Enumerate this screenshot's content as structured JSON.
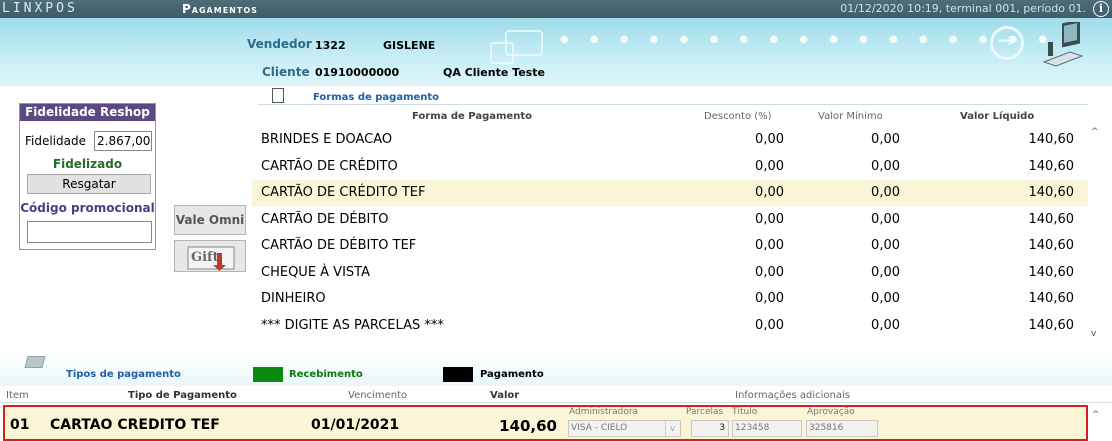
{
  "titlebar": {
    "logo": "LINXPOS",
    "section": "Pagamentos",
    "status": "01/12/2020 10:19, terminal 001, período 01.",
    "info_glyph": "i"
  },
  "header": {
    "vendedor_label": "Vendedor",
    "vendedor_code": "1322",
    "vendedor_name": "GISLENE",
    "cliente_label": "Cliente",
    "cliente_code": "01910000000",
    "cliente_name": "QA Cliente Teste"
  },
  "fidelidade": {
    "title": "Fidelidade Reshop",
    "label": "Fidelidade",
    "value": "2.867,00",
    "status": "Fidelizado",
    "resgatar": "Resgatar",
    "promo_label": "Código promocional",
    "promo_value": ""
  },
  "buttons": {
    "vale_omni": "Vale Omni",
    "gift_card": "Gift"
  },
  "formas": {
    "title": "Formas de pagamento",
    "columns": {
      "forma": "Forma de Pagamento",
      "desconto": "Desconto (%)",
      "minimo": "Valor Mínimo",
      "liquido": "Valor Líquido"
    },
    "rows": [
      {
        "name": "BRINDES E DOACAO",
        "desconto": "0,00",
        "minimo": "0,00",
        "liquido": "140,60"
      },
      {
        "name": "CARTÃO DE CRÉDITO",
        "desconto": "0,00",
        "minimo": "0,00",
        "liquido": "140,60"
      },
      {
        "name": "CARTÃO DE CRÉDITO TEF",
        "desconto": "0,00",
        "minimo": "0,00",
        "liquido": "140,60"
      },
      {
        "name": "CARTÃO DE DÉBITO",
        "desconto": "0,00",
        "minimo": "0,00",
        "liquido": "140,60"
      },
      {
        "name": "CARTÃO DE DÉBITO TEF",
        "desconto": "0,00",
        "minimo": "0,00",
        "liquido": "140,60"
      },
      {
        "name": "CHEQUE À VISTA",
        "desconto": "0,00",
        "minimo": "0,00",
        "liquido": "140,60"
      },
      {
        "name": "DINHEIRO",
        "desconto": "0,00",
        "minimo": "0,00",
        "liquido": "140,60"
      },
      {
        "name": "*** DIGITE AS PARCELAS ***",
        "desconto": "0,00",
        "minimo": "0,00",
        "liquido": "140,60"
      }
    ],
    "selected_index": 2
  },
  "legend": {
    "tipos": "Tipos de pagamento",
    "recebimento": "Recebimento",
    "pagamento": "Pagamento",
    "recebimento_color": "#0d8a0d",
    "pagamento_color": "#000000"
  },
  "payments": {
    "columns": {
      "item": "Item",
      "tipo": "Tipo de Pagamento",
      "vencimento": "Vencimento",
      "valor": "Valor",
      "info": "Informações adicionais"
    },
    "rows": [
      {
        "item": "01",
        "tipo": "CARTAO CREDITO TEF",
        "vencimento": "01/01/2021",
        "valor": "140,60",
        "administradora_label": "Administradora",
        "administradora": "VISA - CIELO",
        "parcelas_label": "Parcelas",
        "parcelas": "3",
        "titulo_label": "Título",
        "titulo": "123458",
        "aprovacao_label": "Aprovação",
        "aprovacao": "325816"
      }
    ]
  },
  "colors": {
    "title_bg": "#466570",
    "header_bg": "#b3e6f1",
    "fid_header": "#5b4a82",
    "selected_row": "#fbf5d8",
    "highlight_border": "#d21f1f",
    "link_blue": "#1f5fa8"
  }
}
